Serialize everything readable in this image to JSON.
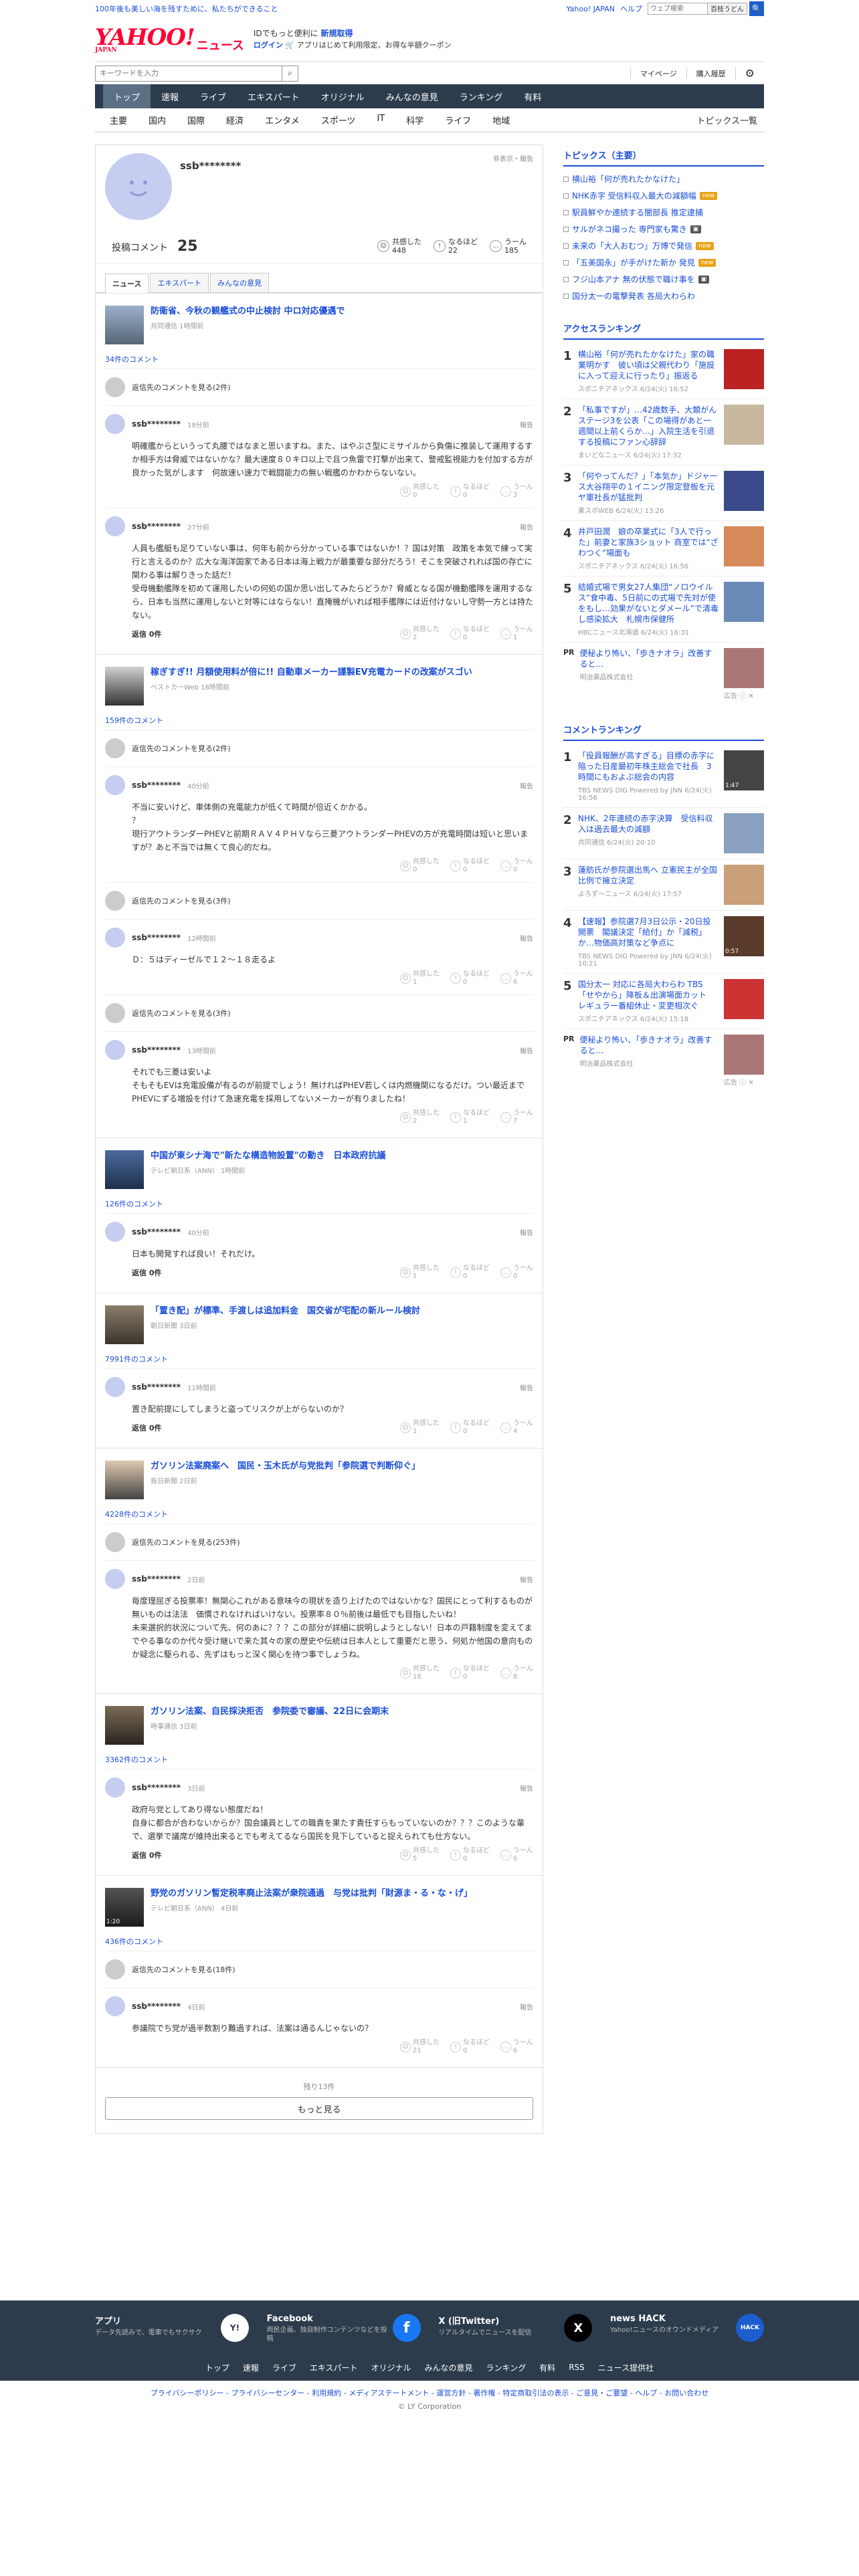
{
  "topbar": {
    "tagline": "100年後も美しい海を残すために、私たちができること",
    "right_links": [
      "Yahoo! JAPAN",
      "ヘルプ"
    ],
    "search_placeholder": "ウェブ検索",
    "search_btn": "百枝うどん",
    "search_go": "🔍"
  },
  "header": {
    "logo": "YAHOO!",
    "logo_sub": "JAPAN",
    "logo_news": "ニュース",
    "promo_line1_a": "IDでもっと便利に",
    "promo_line1_b": "新規取得",
    "promo_line2_a": "ログイン",
    "promo_line2_b": "🛒 アプリはじめて利用限定、お得な半額クーポン"
  },
  "searchrow": {
    "placeholder": "キーワードを入力",
    "links": [
      "マイページ",
      "購入履歴"
    ],
    "gear": "⚙"
  },
  "nav1": [
    "トップ",
    "速報",
    "ライブ",
    "エキスパート",
    "オリジナル",
    "みんなの意見",
    "ランキング",
    "有料"
  ],
  "nav2": {
    "items": [
      "主要",
      "国内",
      "国際",
      "経済",
      "エンタメ",
      "スポーツ",
      "IT",
      "科学",
      "ライフ",
      "地域"
    ],
    "right": "トピックス一覧"
  },
  "profile": {
    "name": "ssb********",
    "links": "非表示・報告",
    "comments_label": "投稿コメント",
    "comments_count": "25",
    "reactions": [
      {
        "icon": "☺",
        "label": "共感した",
        "count": "448"
      },
      {
        "icon": "!",
        "label": "なるほど",
        "count": "22"
      },
      {
        "icon": "…",
        "label": "うーん",
        "count": "185"
      }
    ],
    "tabs": [
      "ニュース",
      "エキスパート",
      "みんなの意見"
    ]
  },
  "articles": [
    {
      "title": "防衛省、今秋の観艦式の中止検討 中ロ対応優遇で",
      "src": "共同通信 1時間前",
      "count": "34件のコメント",
      "other": "返信先のコメントを見る(2件)",
      "comments": [
        {
          "name": "ssb********",
          "time": "18分前",
          "text": "…",
          "reply": "",
          "votes": [
            "0",
            "0",
            "3"
          ]
        },
        {
          "name": "ssb********",
          "time": "27分前",
          "text": "…",
          "reply": "返信 0件",
          "votes": [
            "2",
            "0",
            "1"
          ]
        }
      ]
    },
    {
      "title": "稼ぎすぎ!! 月額使用料が倍に!! 自動車メーカー謹製EV充電カードの改案がスゴい",
      "src": "ベストカーWeb 18時間前",
      "count": "159件のコメント",
      "other": "返信先のコメントを見る(2件)",
      "comments": [
        {
          "name": "ssb********",
          "time": "40分前",
          "text": "",
          "reply": "",
          "votes": [
            "0",
            "0",
            "0"
          ]
        }
      ]
    }
  ],
  "c1": "明確艦からというって丸腰ではなまと思いますね。また、はやぶさ型にミサイルから負傷に推装して運用するすか相手方は脅威ではないかな？最大速度８０キロ以上で且つ魚雷で打撃が出来て、警戒監視能力を付加する方が良かった気がします　何故速い速力で戦闘能力の無い戦艦のかわからないない。",
  "c2": "人員も艦艇も足りていない事は、何年も前から分かっている事ではないか！？国は対策　政策を本気で練って実行と言えるのか？広大な海洋国家である日本は海上戦力が最重要な部分だろう！そこを突破されれば国の存亡に関わる事は解りきった話だ！\n受母機動艦隊を初めて運用したいの何処の国か思い出してみたらどうか？脅威となる国が機動艦隊を運用するなら、日本も当然に運用しないと対等にはならない！直掩機がいれば相手艦隊には近付けないし守勢一方とは持たない。",
  "c3": "不当に安いけど、車体側の充電能力が低くて時間が倍近くかかる。\n？\n現行アウトランダーPHEVと前期ＲＡＶ４ＰＨＶなら三菱アウトランダーPHEVの方が充電時間は短いと思いますが？あと不当では無くて良心的だね。",
  "c4": "Ｄ：５はディーゼルで１２〜１８走るよ",
  "c5": "それでも三菱は安いよ\nそもそもEVは充電設備が有るのが前提でしょう！無ければPHEV若しくは内燃機関になるだけ。つい最近までPHEVにずる増設を付けて急速充電を採用してないメーカーが有りましたね！",
  "a3": {
    "title": "中国が東シナ海で\"新たな構造物設置\"の動き　日本政府抗議",
    "src": "テレビ朝日系（ANN） 1時間前",
    "count": "126件のコメント",
    "name": "ssb********",
    "time": "40分前",
    "text": "日本も開発すれば良い！それだけ。",
    "votes": [
      "1",
      "0",
      "0"
    ]
  },
  "a4": {
    "title": "「置き配」が標準、手渡しは追加料金　国交省が宅配の新ルール検討",
    "src": "朝日新聞 3日前",
    "count": "7991件のコメント",
    "name": "ssb********",
    "time": "11時間前",
    "text": "置き配前提にしてしまうと盗ってリスクが上がらないのか？",
    "votes": [
      "1",
      "0",
      "4"
    ]
  },
  "a5": {
    "title": "ガソリン法案廃案へ　国民・玉木氏が与党批判「参院選で判断仰ぐ」",
    "src": "毎日新聞 2日前",
    "count": "4228件のコメント",
    "other": "返信先のコメントを見る(253件)",
    "name": "ssb********",
    "time": "2日前",
    "text": "毎度理屈ぎる投票率！無関心これがある意味今の現状を造り上げたのではないかな？国民にとって利するものが無いものは法法　価慣されなければいけない。投票率８０％前後は最低でも目指したいね！\n未来選択的状況について先、何のあに？？？この部分が詳細に説明しようとしない！日本の戸籍制度を変えてまでやる事なのか代々受け継いで来た其々の家の歴史や伝統は日本人として重要だと思う、何処か他国の意向ものか疑念に駆られる、先ずはもっと深く関心を待つ事でしょうね。",
    "votes": [
      "18",
      "0",
      "8"
    ]
  },
  "a6": {
    "title": "ガソリン法案、自民採決拒否　参院委で審議、22日に会期末",
    "src": "時事通信 3日前",
    "count": "3362件のコメント",
    "name": "ssb********",
    "time": "3日前",
    "text": "政府与党としてあり得ない態度だね！\n自身に都合が合わないからか？国会議員としての職責を果たす責任すらもっていないのか？？？このような輩で、選挙で議席が維持出来るとでも考えてるなら国民を見下していると捉えられても仕方ない。",
    "votes": [
      "5",
      "0",
      "6"
    ]
  },
  "a7": {
    "title": "野党のガソリン暫定税率廃止法案が衆院通過　与党は批判「財源ま・る・な・げ」",
    "src": "テレビ朝日系（ANN） 4日前",
    "count": "436件のコメント",
    "other": "返信先のコメントを見る(18件)",
    "name": "ssb********",
    "time": "4日前",
    "text": "参議院でち党が過半数割り難過すれば、法案は通るんじゃないの？",
    "votes": [
      "21",
      "0",
      "6"
    ],
    "dur": "1:20"
  },
  "more": {
    "remaining": "残り13件",
    "button": "もっと見る"
  },
  "reply_label": "返信 0件",
  "report": "報告",
  "vote_labels": [
    "共感した",
    "なるほど",
    "うーん"
  ],
  "topics": {
    "title": "トピックス（主要）",
    "items": [
      {
        "t": "横山裕「何が売れたかなけた」",
        "tag": ""
      },
      {
        "t": "NHK赤字 受信料収入最大の減額幅",
        "tag": "new"
      },
      {
        "t": "駅員鮮やか連続する闇部長 推定逮捕",
        "tag": ""
      },
      {
        "t": "サルがネコ撮った 専門家も驚き",
        "tag": "img"
      },
      {
        "t": "未来の「大人おむつ」万博で発信",
        "tag": "new"
      },
      {
        "t": "「五美国永」が手がけた新か 発見",
        "tag": "new"
      },
      {
        "t": "フジ山本アナ 無の伏態で職け事を",
        "tag": "img"
      },
      {
        "t": "国分太一の電撃発表 各局大わらわ",
        "tag": ""
      }
    ]
  },
  "access": {
    "title": "アクセスランキング",
    "items": [
      {
        "n": "1",
        "t": "横山裕「何が売れたかなけた」家の職業明かす　彼い頃は父親代わり「施設に入って迎えに行ったり」振返る",
        "s": "スポニチアネックス 6/24(火) 16:52"
      },
      {
        "n": "2",
        "t": "「私事ですが」…42歳数手、大類がんステージ3を公表「この場得があと一週間以上前くらか…」入院生活を引退する投稿にファン心辞辞",
        "s": "まいどなニュース 6/24(火) 17:32"
      },
      {
        "n": "3",
        "t": "「何やってんだ？」「本気か」ドジャース大谷翔平の１イニング限定登板を元ヤ軍社長が猛批判",
        "s": "東スポWEB 6/24(火) 13:26"
      },
      {
        "n": "4",
        "t": "井戸田潤　娘の卒業式に「3人で行った」前妻と家族3ショット 商室では“ざわつく”場面も",
        "s": "スポニチアネックス 6/24(火) 16:56"
      },
      {
        "n": "5",
        "t": "結婚式場で男女27人集団“ノロウイルス”食中毒、5日前にの式場で先対が使をもし…効果がないとダメール”で清毒し感染拡大　札幌市保健所",
        "s": "HBCニュース北海道 6/24(火) 16:31"
      }
    ]
  },
  "pr1": {
    "label": "PR",
    "t": "便秘より怖い、「歩きナオラ」改善すると…",
    "s": "明治薬品株式会社",
    "ad": "広告 ⓘ ✕"
  },
  "commentrank": {
    "title": "コメントランキング",
    "items": [
      {
        "n": "1",
        "t": "「役員報酬が高すぎる」目標の赤字に陥った日産最初年株主総会で社長　3時間にもおよぶ総会の内容",
        "s": "TBS NEWS DIG Powered by JNN 6/24(火) 16:56",
        "dur": "1:47"
      },
      {
        "n": "2",
        "t": "NHK、2年連続の赤字決算　受信料収入は過去最大の減額",
        "s": "共同通信 6/24(火) 20:10",
        "dur": ""
      },
      {
        "n": "3",
        "t": "蓮舫氏が参院選出馬へ 立憲民主が全国比例で擁立決定",
        "s": "よろず〜ニュース 6/24(火) 17:57",
        "dur": ""
      },
      {
        "n": "4",
        "t": "【速報】参院選7月3日公示・20日投開票　閣議決定「給付」か「減税」か…物価高対策など争点に",
        "s": "TBS NEWS DIG Powered by JNN 6/24(火) 10:21",
        "dur": "0:57"
      },
      {
        "n": "5",
        "t": "国分太一 対応に各局大わらわ TBS「せやから」降板＆出演場面カット　レギュラー番組休止・変更相次ぐ",
        "s": "スポニチアネックス 6/24(火) 15:18",
        "dur": ""
      }
    ]
  },
  "pr2": {
    "label": "PR",
    "t": "便秘より怖い、「歩きナオラ」改善すると…",
    "s": "明治薬品株式会社",
    "ad": "広告 ⓘ ✕"
  },
  "footer": {
    "cards": [
      {
        "t": "アプリ",
        "d": "データ先読みで、電車でもサクサク",
        "icon": "Y!"
      },
      {
        "t": "Facebook",
        "d": "両民企画、独自制作コンテンツなどを投稿",
        "icon": "f"
      },
      {
        "t": "X (旧Twitter)",
        "d": "リアルタイムでニュースを配信",
        "icon": "X"
      },
      {
        "t": "news HACK",
        "d": "Yahoo!ニュースのオウンドメディア",
        "icon": "HACK"
      }
    ],
    "nav": [
      "トップ",
      "速報",
      "ライブ",
      "エキスパート",
      "オリジナル",
      "みんなの意見",
      "ランキング",
      "有料",
      "RSS",
      "ニュース提供社"
    ],
    "links": "プライバシーポリシー - プライバシーセンター - 利用規約 - メディアステートメント - 運営方針 - 著作権 - 特定商取引法の表示 - ご意見・ご要望 - ヘルプ - お問い合わせ",
    "copy": "© LY Corporation",
    "colors": {
      "nav": "#2d3c4d",
      "link": "#1a4ed8"
    }
  }
}
